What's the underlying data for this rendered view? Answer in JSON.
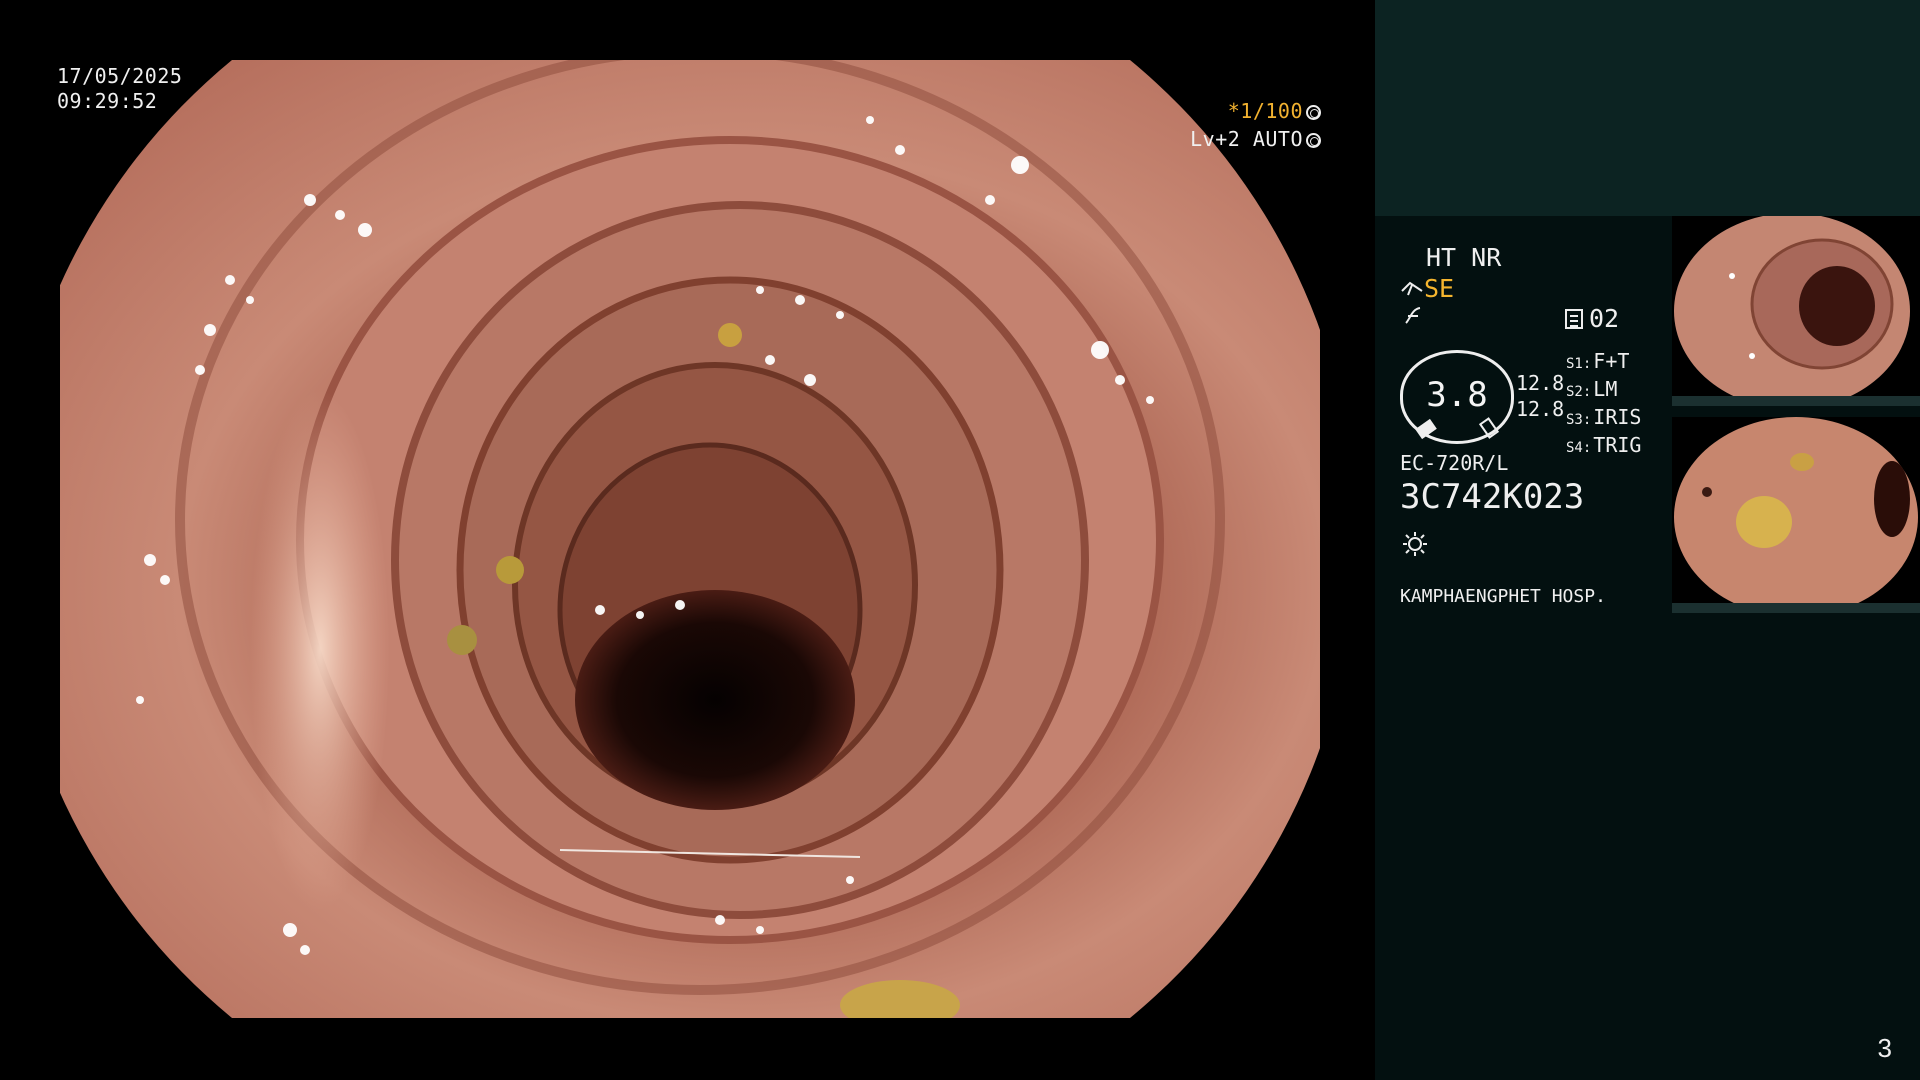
{
  "overlay": {
    "date": "17/05/2025",
    "time": "09:29:52",
    "shutter": "*1/100",
    "level": "Lv+2",
    "mode": "AUTO"
  },
  "panel": {
    "mode_labels": "HT NR",
    "enhancement": "SE",
    "memory": "02",
    "gauge_value": "3.8",
    "pressure_1": "12.8",
    "pressure_2": "12.8",
    "settings": [
      {
        "key": "S1:",
        "value": "F+T"
      },
      {
        "key": "S2:",
        "value": "LM"
      },
      {
        "key": "S3:",
        "value": "IRIS"
      },
      {
        "key": "S4:",
        "value": "TRIG"
      }
    ],
    "model": "EC-720R/L",
    "serial": "3C742K023",
    "hospital": "KAMPHAENGPHET HOSP.",
    "icons": {
      "enhancement": "scope-curve-icon",
      "filter": "filter-icon",
      "memory": "memory-icon",
      "light": "light-icon"
    }
  },
  "colors": {
    "accent": "#f2b230",
    "panel_top": "#0c2322",
    "panel": "#031010",
    "mucosa": "#c2806c"
  },
  "page": {
    "number": "3"
  }
}
